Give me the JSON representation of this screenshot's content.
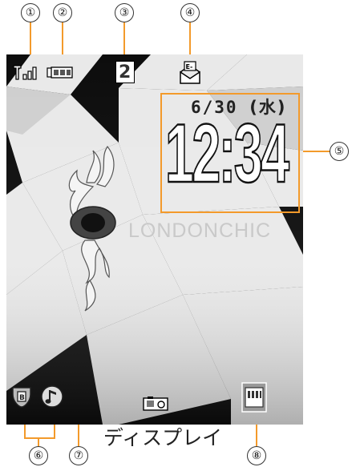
{
  "callouts": [
    "①",
    "②",
    "③",
    "④",
    "⑤",
    "⑥",
    "⑦",
    "⑧"
  ],
  "caption": "ディスプレイ",
  "clock": {
    "date": "6/30",
    "weekday": "(水)",
    "time": "12:34"
  },
  "wallpaper": {
    "brand_text": "LONDONCHIC"
  },
  "status_icons": {
    "signal": "signal-strength-icon",
    "battery": "battery-icon",
    "mode_number": "2",
    "mail": "mail-notification-icon",
    "bottom_left_1": "status-indicator-icon",
    "bottom_left_2": "music-note-icon",
    "bottom_mid": "recorder-icon",
    "bottom_right": "memory-card-icon"
  },
  "colors": {
    "accent": "#f39a2b",
    "screen_bg": "#000000"
  }
}
